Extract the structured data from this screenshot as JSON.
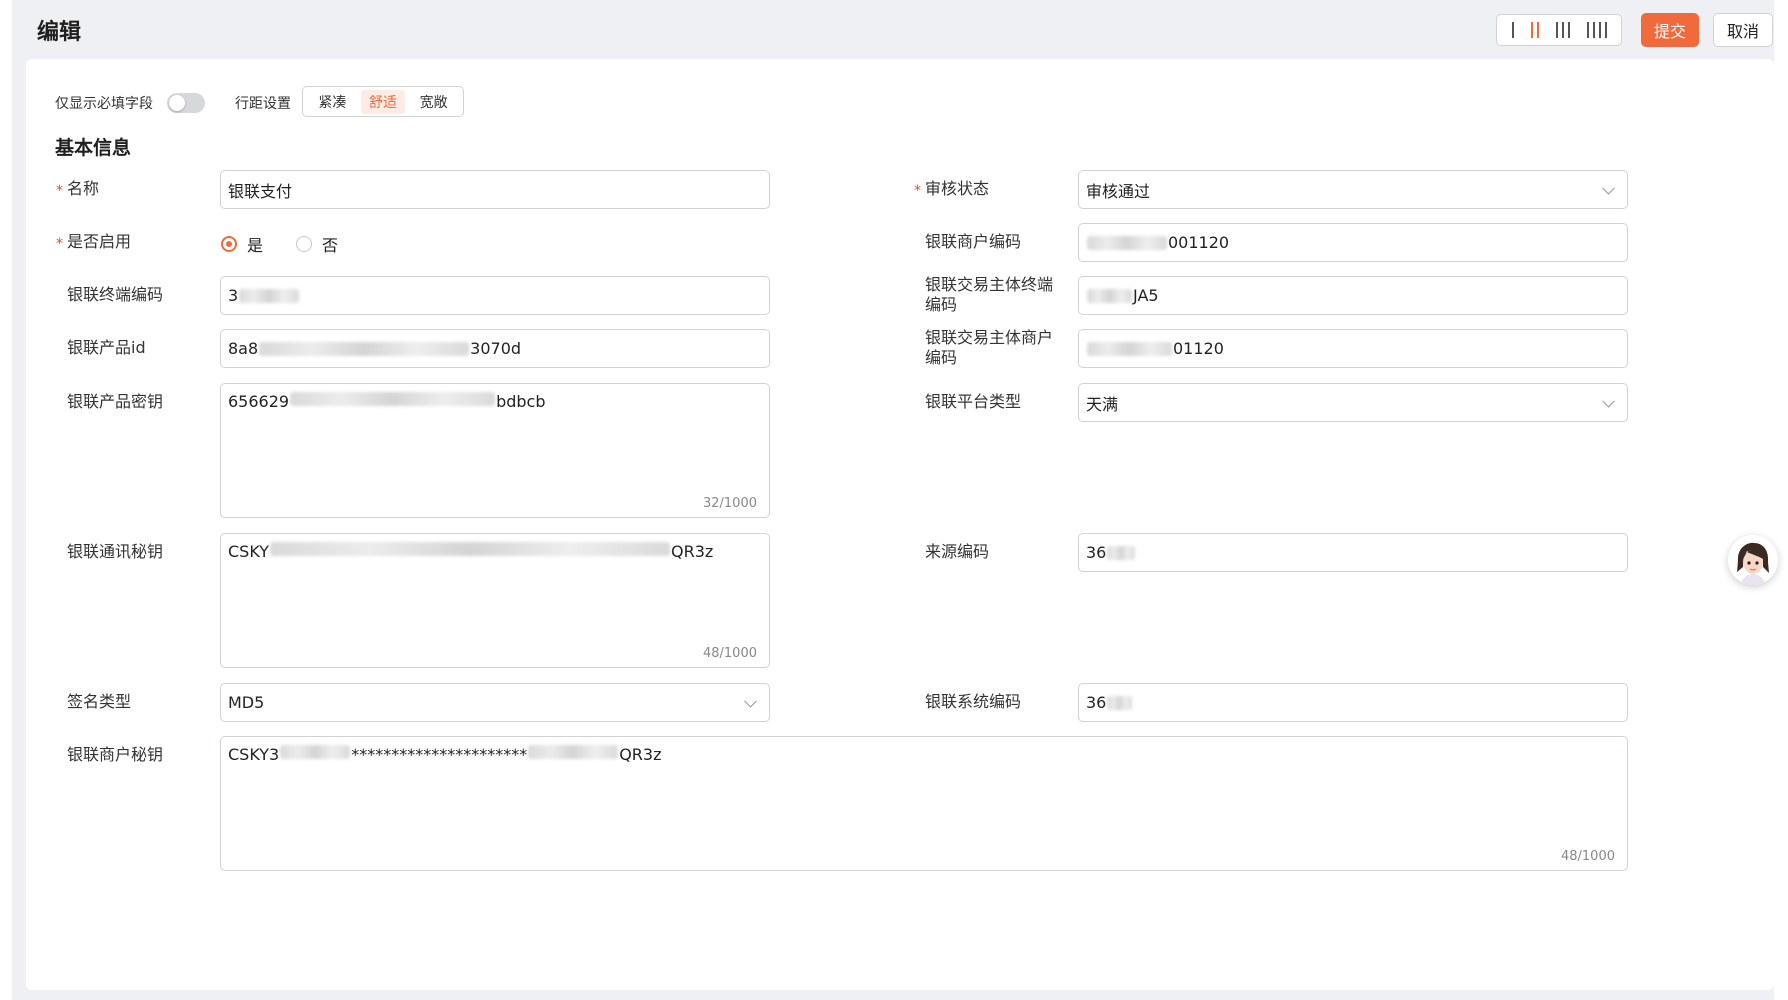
{
  "header": {
    "title": "编辑",
    "submit_label": "提交",
    "cancel_label": "取消",
    "column_options": [
      "1",
      "2",
      "3",
      "4"
    ],
    "active_column": "2"
  },
  "options": {
    "required_only_label": "仅显示必填字段",
    "required_only_on": false,
    "spacing_label": "行距设置",
    "spacing_options": [
      "紧凑",
      "舒适",
      "宽敞"
    ],
    "spacing_selected": "舒适"
  },
  "section_title": "基本信息",
  "form": {
    "name": {
      "label": "名称",
      "value": "银联支付",
      "required": true
    },
    "enabled": {
      "label": "是否启用",
      "yes": "是",
      "no": "否",
      "selected": "是",
      "required": true
    },
    "terminal_code": {
      "label": "银联终端编码",
      "value_prefix": "3",
      "value_suffix": ""
    },
    "product_id": {
      "label": "银联产品id",
      "value_prefix": "8a8",
      "value_suffix": "3070d"
    },
    "product_key": {
      "label": "银联产品密钥",
      "value_prefix": "656629",
      "value_suffix": "bdbcb",
      "counter": "32/1000"
    },
    "comm_key": {
      "label": "银联通讯秘钥",
      "value_prefix": "CSKY",
      "value_suffix": "QR3z",
      "counter": "48/1000"
    },
    "sign_type": {
      "label": "签名类型",
      "value": "MD5"
    },
    "merchant_key": {
      "label": "银联商户秘钥",
      "value_prefix": "CSKY3",
      "value_middle": "**********************",
      "value_suffix": "QR3z",
      "counter": "48/1000"
    },
    "audit_status": {
      "label": "审核状态",
      "value": "审核通过",
      "required": true
    },
    "merchant_code": {
      "label": "银联商户编码",
      "value_prefix": "",
      "value_suffix": "001120"
    },
    "trade_terminal_code": {
      "label": "银联交易主体终端编码",
      "value_prefix": "",
      "value_suffix": "JA5"
    },
    "trade_merchant_code": {
      "label": "银联交易主体商户编码",
      "value_prefix": "",
      "value_suffix": "01120"
    },
    "platform_type": {
      "label": "银联平台类型",
      "value": "天满"
    },
    "source_code": {
      "label": "来源编码",
      "value_prefix": "36",
      "value_suffix": ""
    },
    "system_code": {
      "label": "银联系统编码",
      "value_prefix": "36",
      "value_suffix": ""
    }
  },
  "colors": {
    "accent": "#f06a3c",
    "required": "#e34d3a"
  }
}
